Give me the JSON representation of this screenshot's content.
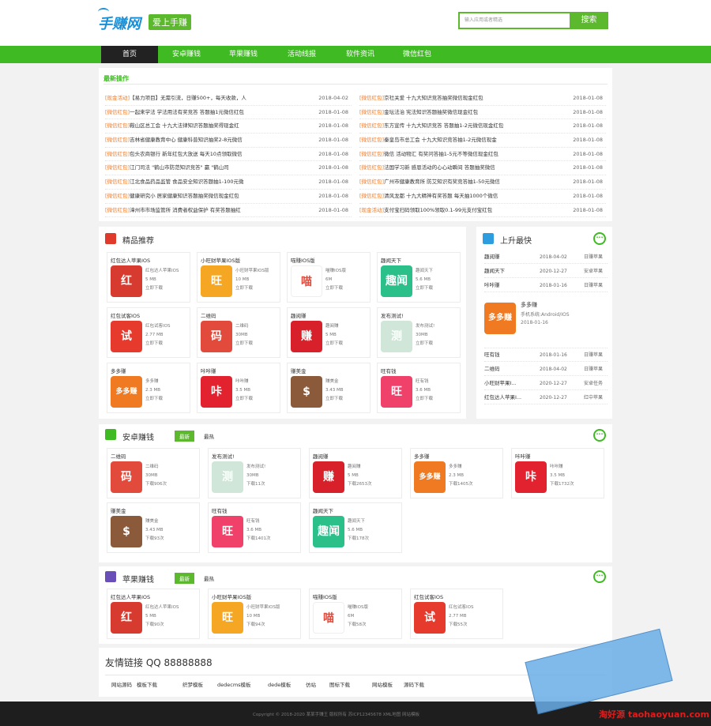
{
  "header": {
    "logo": "手赚网",
    "badge": "爱上手赚",
    "search_placeholder": "输入应用或者精选",
    "search_button": "搜索"
  },
  "nav": [
    "首页",
    "安卓赚钱",
    "苹果赚钱",
    "活动线报",
    "软件资讯",
    "微信红包"
  ],
  "latest": {
    "title": "最新操作",
    "left": [
      {
        "tag": "[现金活动]",
        "text": "【易力项目】无需引流，日赚500+，每天收款，人",
        "date": "2018-04-02"
      },
      {
        "tag": "[微信红包]",
        "text": "一起来学法 学法用法有奖竞答 答题抽1元微信红包",
        "date": "2018-01-08"
      },
      {
        "tag": "[微信红包]",
        "text": "鞍山区总工会 十九大法律知识答题抽奖得现金红",
        "date": "2018-01-08"
      },
      {
        "tag": "[微信红包]",
        "text": "吉林省健康教育中心 健康科普知识抽奖2-8元微信",
        "date": "2018-01-08"
      },
      {
        "tag": "[微信红包]",
        "text": "包头农商银行 新年红包大放送 每天10点领取微信",
        "date": "2018-01-08"
      },
      {
        "tag": "[微信红包]",
        "text": "江门司法 \"鹤山市防范知识竞答\" 赢 \"鹤山司",
        "date": "2018-01-08"
      },
      {
        "tag": "[微信红包]",
        "text": "江北食品药品监管 食品安全知识答题抽1-100元微",
        "date": "2018-01-08"
      },
      {
        "tag": "[微信红包]",
        "text": "健康研究小 居家健康知识答题抽奖微信现金红包",
        "date": "2018-01-08"
      },
      {
        "tag": "[微信红包]",
        "text": "漳州市市场监管所 消费者权益保护 有奖答题抽红",
        "date": "2018-01-08"
      }
    ],
    "right": [
      {
        "tag": "[微信红包]",
        "text": "京社关爱 十九大知识竞答抽奖微信现金红包",
        "date": "2018-01-08"
      },
      {
        "tag": "[微信红包]",
        "text": "金坛法治 宪法知识答题抽奖微信现金红包",
        "date": "2018-01-08"
      },
      {
        "tag": "[微信红包]",
        "text": "东方宣传 十九大知识竞答 答题抽1-2元微信现金红包",
        "date": "2018-01-08"
      },
      {
        "tag": "[微信红包]",
        "text": "秦皇岛市总工会 十九大知识竞答抽1-2元微信现金",
        "date": "2018-01-08"
      },
      {
        "tag": "[微信红包]",
        "text": "微信 活动物汇 有奖问答抽1-5元不等微信现金红包",
        "date": "2018-01-08"
      },
      {
        "tag": "[微信红包]",
        "text": "法国学习新 感恩活动的心心动瞬间 答题抽奖微信",
        "date": "2018-01-08"
      },
      {
        "tag": "[微信红包]",
        "text": "广州市健康教育所 防艾知识有奖竞答抽1-50元微信",
        "date": "2018-01-08"
      },
      {
        "tag": "[微信红包]",
        "text": "清风龙都 十九大精神有奖答题 每天抽1000个微信",
        "date": "2018-01-08"
      },
      {
        "tag": "[现金活动]",
        "text": "支付宝扫码领取100%领取0.1-99元支付宝红包",
        "date": "2018-01-08"
      }
    ]
  },
  "featured": {
    "title": "精品推荐",
    "download": "立即下载",
    "items": [
      {
        "name": "红包达人苹果IOS",
        "sub": "红包达人苹果IOS",
        "size": "5 MB",
        "icon": "红",
        "color": "#d73a2e"
      },
      {
        "name": "小旺财苹果IOS版",
        "sub": "小旺财苹果IOS版",
        "size": "10 MB",
        "icon": "旺",
        "color": "#f5a623"
      },
      {
        "name": "喵赚IOS版",
        "sub": "喵赚IOS版",
        "size": "6M",
        "icon": "喵",
        "color": "#ffffff"
      },
      {
        "name": "趣闻天下",
        "sub": "趣闻天下",
        "size": "5.6 MB",
        "icon": "趣闻",
        "color": "#2bbf8a"
      },
      {
        "name": "红包试客IOS",
        "sub": "红包试客IOS",
        "size": "2.77 MB",
        "icon": "试",
        "color": "#e63a2d"
      },
      {
        "name": "二维码",
        "sub": "二维码",
        "size": "30MB",
        "icon": "码",
        "color": "#e24a3c"
      },
      {
        "name": "趣阅赚",
        "sub": "趣阅赚",
        "size": "5 MB",
        "icon": "赚",
        "color": "#d8202a"
      },
      {
        "name": "发布测试!",
        "sub": "发布测试!",
        "size": "30MB",
        "icon": "测",
        "color": "#cfe6d8"
      },
      {
        "name": "多多赚",
        "sub": "多多赚",
        "size": "2.3 MB",
        "icon": "多多赚",
        "color": "#f07a22"
      },
      {
        "name": "咔咔赚",
        "sub": "咔咔赚",
        "size": "3.5 MB",
        "icon": "咔",
        "color": "#e2232f"
      },
      {
        "name": "赚美金",
        "sub": "赚美金",
        "size": "3.43 MB",
        "icon": "$",
        "color": "#8a5a3a"
      },
      {
        "name": "旺有钱",
        "sub": "旺有钱",
        "size": "3.6 MB",
        "icon": "旺",
        "color": "#f0416a"
      }
    ]
  },
  "rising": {
    "title": "上升最快",
    "rows_top": [
      {
        "name": "趣阅赚",
        "date": "2018-04-02",
        "src": "日赚苹果"
      },
      {
        "name": "趣闻天下",
        "date": "2020-12-27",
        "src": "安卓苹果"
      },
      {
        "name": "咔咔赚",
        "date": "2018-01-16",
        "src": "日赚苹果"
      }
    ],
    "highlight": {
      "name": "多多赚",
      "desc": "手机系统:Android/IOS",
      "date": "2018-01-16",
      "icon": "多多赚"
    },
    "rows_bottom": [
      {
        "name": "旺有钱",
        "date": "2018-01-16",
        "src": "日赚苹果"
      },
      {
        "name": "二维码",
        "date": "2018-04-02",
        "src": "日赚苹果"
      },
      {
        "name": "小旺财苹果I...",
        "date": "2020-12-27",
        "src": "安卓任务"
      },
      {
        "name": "红包达人苹果I...",
        "date": "2020-12-27",
        "src": "红中苹果"
      }
    ]
  },
  "android": {
    "title": "安卓赚钱",
    "tab_active": "最新",
    "tab_other": "最热",
    "items": [
      {
        "name": "二维码",
        "sub": "二维码",
        "size": "30MB",
        "dl": "下载906次",
        "icon": "码",
        "color": "#e24a3c"
      },
      {
        "name": "发布测试!",
        "sub": "发布测试!",
        "size": "30MB",
        "dl": "下载11次",
        "icon": "测",
        "color": "#cfe6d8"
      },
      {
        "name": "趣阅赚",
        "sub": "趣阅赚",
        "size": "5 MB",
        "dl": "下载2653次",
        "icon": "赚",
        "color": "#d8202a"
      },
      {
        "name": "多多赚",
        "sub": "多多赚",
        "size": "2.3 MB",
        "dl": "下载1405次",
        "icon": "多多赚",
        "color": "#f07a22"
      },
      {
        "name": "咔咔赚",
        "sub": "咔咔赚",
        "size": "3.5 MB",
        "dl": "下载1732次",
        "icon": "咔",
        "color": "#e2232f"
      },
      {
        "name": "赚美金",
        "sub": "赚美金",
        "size": "3.43 MB",
        "dl": "下载93次",
        "icon": "$",
        "color": "#8a5a3a"
      },
      {
        "name": "旺有钱",
        "sub": "旺有钱",
        "size": "3.6 MB",
        "dl": "下载1401次",
        "icon": "旺",
        "color": "#f0416a"
      },
      {
        "name": "趣闻天下",
        "sub": "趣闻天下",
        "size": "5.6 MB",
        "dl": "下载178次",
        "icon": "趣闻",
        "color": "#2bbf8a"
      }
    ]
  },
  "apple": {
    "title": "苹果赚钱",
    "tab_active": "最新",
    "tab_other": "最热",
    "items": [
      {
        "name": "红包达人苹果IOS",
        "sub": "红包达人苹果IOS",
        "size": "5 MB",
        "dl": "下载90次",
        "icon": "红",
        "color": "#d73a2e"
      },
      {
        "name": "小旺财苹果IOS版",
        "sub": "小旺财苹果IOS版",
        "size": "10 MB",
        "dl": "下载94次",
        "icon": "旺",
        "color": "#f5a623"
      },
      {
        "name": "喵赚IOS版",
        "sub": "喵赚IOS版",
        "size": "6M",
        "dl": "下载58次",
        "icon": "喵",
        "color": "#ffffff"
      },
      {
        "name": "红包试客IOS",
        "sub": "红包试客IOS",
        "size": "2.77 MB",
        "dl": "下载55次",
        "icon": "试",
        "color": "#e63a2d"
      }
    ]
  },
  "links": {
    "title": "友情链接 QQ 88888888",
    "items": [
      "网站源码",
      "模板下载",
      "织梦模板",
      "dedecms模板",
      "dede模板",
      "仿站",
      "图标下载",
      "网站模板",
      "源码下载"
    ]
  },
  "footer": {
    "text": "Copyright © 2018-2020 某某手赚王 版权所有 苏ICP12345678 XML地图 网站模板"
  },
  "watermark": "淘好源 taohaoyuan.com"
}
